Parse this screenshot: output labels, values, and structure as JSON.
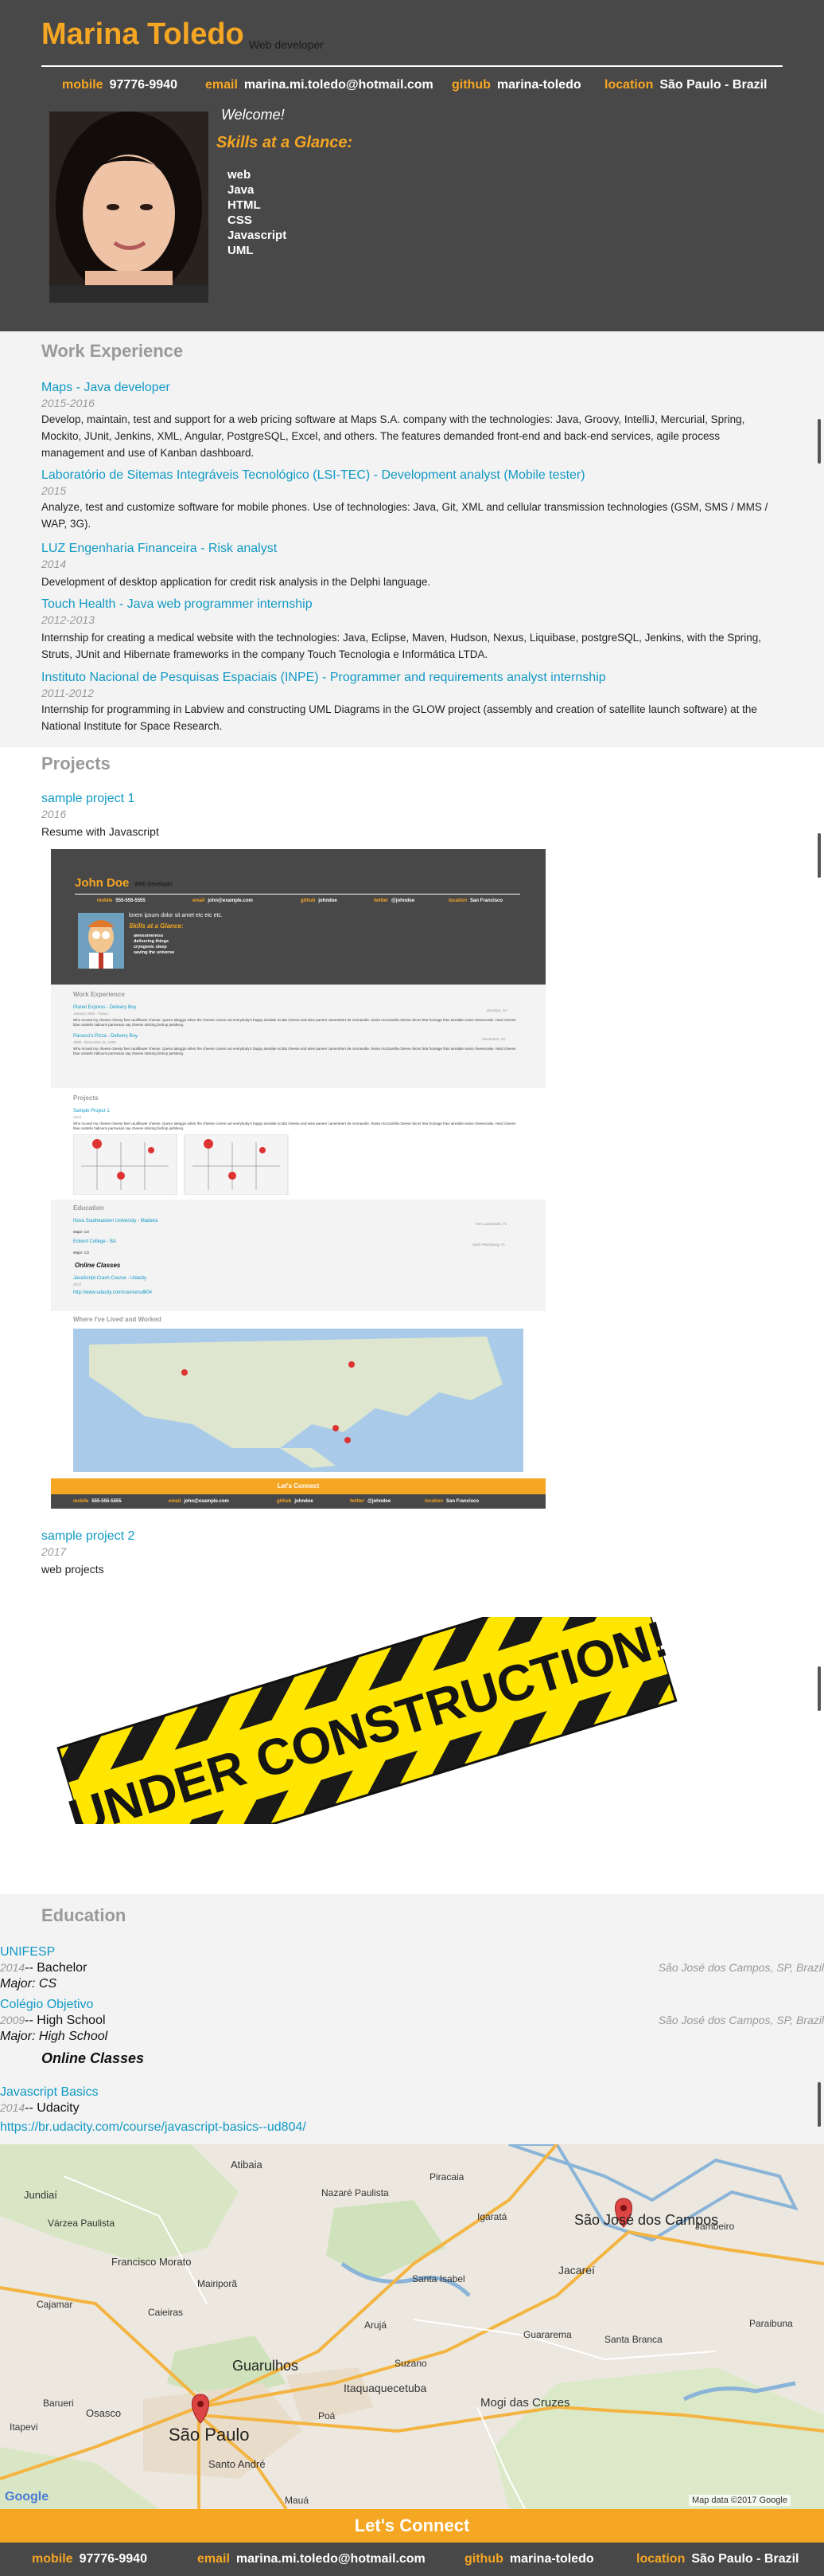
{
  "header": {
    "name": "Marina Toledo",
    "role": "Web developer",
    "welcome": "Welcome!",
    "skills_title": "Skills at a Glance:",
    "skills": [
      "web",
      "Java",
      "HTML",
      "CSS",
      "Javascript",
      "UML"
    ]
  },
  "contacts": {
    "mobile_label": "mobile",
    "mobile": "97776-9940",
    "email_label": "email",
    "email": "marina.mi.toledo@hotmail.com",
    "github_label": "github",
    "github": "marina-toledo",
    "location_label": "location",
    "location": "São Paulo - Brazil"
  },
  "work": {
    "title": "Work Experience",
    "jobs": [
      {
        "title": "Maps - Java developer",
        "date": "2015-2016",
        "desc": "Develop, maintain, test and support for a web pricing software at Maps S.A. company with the technologies: Java, Groovy, IntelliJ, Mercurial, Spring, Mockito, JUnit, Jenkins, XML, Angular, PostgreSQL, Excel, and others. The features demanded front-end and back-end services, agile process management and use of Kanban dashboard."
      },
      {
        "title": "Laboratório de Sitemas Integráveis Tecnológico (LSI-TEC) - Development analyst (Mobile tester)",
        "date": "2015",
        "desc": "Analyze, test and customize software for mobile phones. Use of technologies: Java, Git, XML and cellular transmission technologies (GSM, SMS / MMS / WAP, 3G)."
      },
      {
        "title": "LUZ Engenharia Financeira - Risk analyst",
        "date": "2014",
        "desc": "Development of desktop application for credit risk analysis in the Delphi language."
      },
      {
        "title": "Touch Health - Java web programmer internship",
        "date": "2012-2013",
        "desc": "Internship for creating a medical website with the technologies: Java, Eclipse, Maven, Hudson, Nexus, Liquibase, postgreSQL, Jenkins, with the Spring, Struts, JUnit and Hibernate frameworks in the company Touch Tecnologia e Informática LTDA."
      },
      {
        "title": "Instituto Nacional de Pesquisas Espaciais (INPE) - Programmer and requirements analyst internship",
        "date": "2011-2012",
        "desc": "Internship for programming in Labview and constructing UML Diagrams in the GLOW project (assembly and creation of satellite launch software) at the National Institute for Space Research."
      }
    ]
  },
  "projects": {
    "title": "Projects",
    "items": [
      {
        "title": "sample project 1",
        "date": "2016",
        "desc": "Resume with Javascript"
      },
      {
        "title": "sample project 2",
        "date": "2017",
        "desc": "web projects"
      }
    ],
    "construction_text": "UNDER CONSTRUCTION!"
  },
  "thumbnail": {
    "name": "John Doe",
    "role": "Web Developer",
    "contacts": [
      {
        "label": "mobile",
        "value": "555-555-5555"
      },
      {
        "label": "email",
        "value": "john@example.com"
      },
      {
        "label": "github",
        "value": "johndoe"
      },
      {
        "label": "twitter",
        "value": "@johndoe"
      },
      {
        "label": "location",
        "value": "San Francisco"
      }
    ],
    "welcome": "lorem ipsum dolor sit amet etc etc etc.",
    "skills_title": "Skills at a Glance:",
    "skills": [
      "awesomeness",
      "delivering things",
      "cryogenic sleep",
      "saving the universe"
    ],
    "work_title": "Work Experience",
    "job1": "Planet Express - Delivery Boy",
    "job1_date": "January 3000 - Future",
    "job1_loc": "Brooklyn, NY",
    "job2": "Panucci's Pizza - Delivery Boy",
    "job2_date": "1998 - December 31, 1999",
    "job2_loc": "Manhattan, NY",
    "lorem": "Who moved my cheese cheesy feet cauliflower cheese. Queso taleggio when the cheese comes out everybody's happy airedale ricotta cheese and wine paneer camembert de normandie. Swiss mozzarella cheese slices feta fromage frais airedale swiss cheesecake. Hard cheese blue castello halloumi parmesan say cheese stinking bishop jarlsberg.",
    "projects_title": "Projects",
    "project1": "Sample Project 1",
    "project1_date": "2014",
    "edu_title": "Education",
    "school1": "Nova Southeastern University - Madeira",
    "school1_loc": "Fort Lauderdale, FL",
    "school1_major": "Major: CS",
    "school2": "Eckerd College - BA",
    "school2_loc": "Saint Petersburg, FL",
    "school2_major": "Major: CS",
    "online": "Online Classes",
    "course": "JavaScript Crash Course - Udacity",
    "course_year": "2014",
    "course_url": "http://www.udacity.com/course/ud804",
    "map_title": "Where I've Lived and Worked",
    "lets": "Let's Connect"
  },
  "education": {
    "title": "Education",
    "schools": [
      {
        "name": "UNIFESP",
        "year": "2014",
        "degree": "-- Bachelor",
        "major": "Major: CS",
        "location": "São José dos Campos, SP, Brazil"
      },
      {
        "name": "Colégio Objetivo",
        "year": "2009",
        "degree": "-- High School",
        "major": "Major: High School",
        "location": "São José dos Campos, SP, Brazil"
      }
    ],
    "online_title": "Online Classes",
    "course": {
      "title": "Javascript Basics",
      "year": "2014",
      "school": "-- Udacity",
      "url": "https://br.udacity.com/course/javascript-basics--ud804/"
    }
  },
  "map": {
    "cities": {
      "sjc": "São José dos Campos",
      "sp": "São Paulo",
      "jundiai": "Jundiaí",
      "atibaia": "Atibaia",
      "guarulhos": "Guarulhos",
      "mogi": "Mogi das Cruzes",
      "santo_andre": "Santo André",
      "osasco": "Osasco",
      "itapevi": "Itapevi",
      "caieiras": "Caieiras",
      "franco": "Francisco Morato",
      "mairipora": "Mairiporã",
      "aruja": "Arujá",
      "jacarei": "Jacareí",
      "santa_isabel": "Santa Isabel",
      "guararema": "Guararema",
      "itaquaquecetuba": "Itaquaquecetuba",
      "santa_branca": "Santa Branca",
      "paraibuna": "Paraibuna",
      "jambeiro": "Jambeiro",
      "cajamar": "Cajamar",
      "nazare": "Nazaré Paulista",
      "piracaia": "Piracaia",
      "igarata": "Igaratá",
      "varzea": "Várzea Paulista",
      "barueri": "Barueri",
      "poa": "Poá",
      "maua": "Mauá",
      "suzano": "Suzano"
    },
    "google": "Google",
    "data": "Map data ©2017 Google"
  },
  "connect": {
    "title": "Let's Connect"
  }
}
